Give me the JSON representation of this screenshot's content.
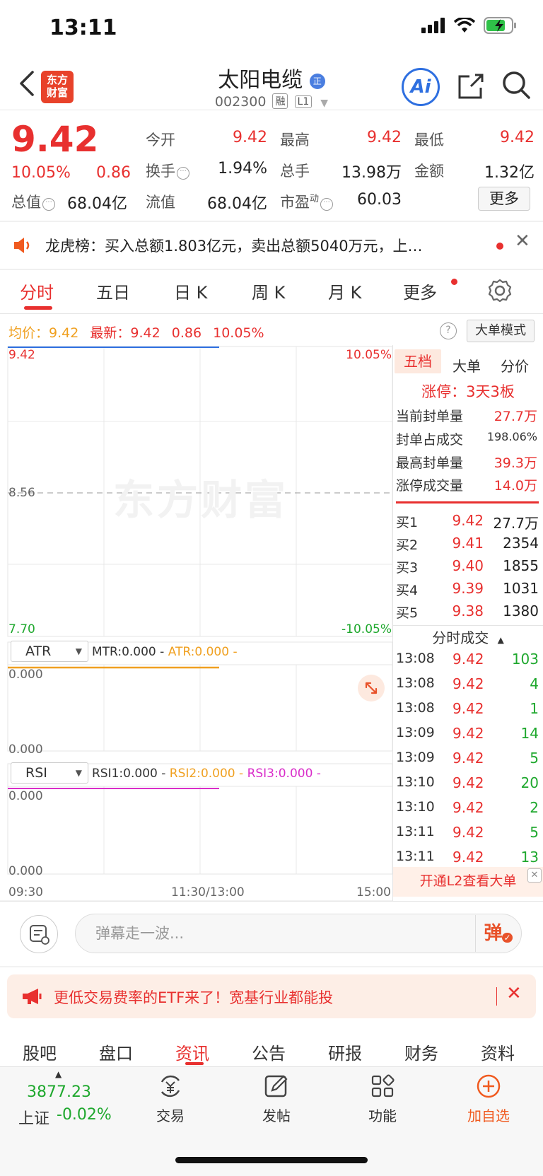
{
  "status": {
    "time": "13:11"
  },
  "header": {
    "logo": "东方\n财富",
    "name": "太阳电缆",
    "code": "002300",
    "tag_rong": "融",
    "tag_level": "L1",
    "ai_label": "Ai"
  },
  "quote": {
    "price": "9.42",
    "pct": "10.05%",
    "change": "0.86",
    "open_label": "今开",
    "open": "9.42",
    "high_label": "最高",
    "high": "9.42",
    "low_label": "最低",
    "low": "9.42",
    "turnover_label": "换手",
    "turnover": "1.94%",
    "volume_label": "总手",
    "volume": "13.98万",
    "amount_label": "金额",
    "amount": "1.32亿",
    "mktcap_label": "总值",
    "mktcap": "68.04亿",
    "float_label": "流值",
    "float": "68.04亿",
    "pe_label": "市盈",
    "pe_sup": "动",
    "pe": "60.03",
    "more": "更多"
  },
  "notice": {
    "text": "龙虎榜：买入总额1.803亿元，卖出总额5040万元，上…"
  },
  "chart_tabs": [
    "分时",
    "五日",
    "日 K",
    "周 K",
    "月 K",
    "更多"
  ],
  "info_line": {
    "avg_label": "均价：",
    "avg": "9.42",
    "latest_label": "最新：",
    "latest": "9.42",
    "change": "0.86",
    "pct": "10.05%",
    "big_order_mode": "大单模式"
  },
  "chart": {
    "watermark": "东方财富",
    "y_top": "9.42",
    "y_mid": "8.56",
    "y_bottom": "7.70",
    "pct_top": "10.05%",
    "pct_bottom": "-10.05%",
    "x_start": "09:30",
    "x_mid": "11:30/13:00",
    "x_end": "15:00",
    "atr": {
      "select": "ATR",
      "mtr": "MTR:0.000 -",
      "atr": "ATR:0.000 -",
      "top": "0.000",
      "bottom": "0.000"
    },
    "rsi": {
      "select": "RSI",
      "rsi1": "RSI1:0.000 -",
      "rsi2": "RSI2:0.000 -",
      "rsi3": "RSI3:0.000 -",
      "top": "0.000",
      "bottom": "0.000"
    }
  },
  "right_panel": {
    "tabs": [
      "五档",
      "大单",
      "分价"
    ],
    "limit_up": "涨停：3天3板",
    "stats": [
      {
        "label": "当前封单量",
        "value": "27.7万"
      },
      {
        "label": "封单占成交",
        "value": "198.06%"
      },
      {
        "label": "最高封单量",
        "value": "39.3万"
      },
      {
        "label": "涨停成交量",
        "value": "14.0万"
      }
    ],
    "bids": [
      {
        "label": "买1",
        "price": "9.42",
        "vol": "27.7万"
      },
      {
        "label": "买2",
        "price": "9.41",
        "vol": "2354"
      },
      {
        "label": "买3",
        "price": "9.40",
        "vol": "1855"
      },
      {
        "label": "买4",
        "price": "9.39",
        "vol": "1031"
      },
      {
        "label": "买5",
        "price": "9.38",
        "vol": "1380"
      }
    ],
    "ticks_title": "分时成交",
    "ticks": [
      {
        "time": "13:08",
        "price": "9.42",
        "vol": "103"
      },
      {
        "time": "13:08",
        "price": "9.42",
        "vol": "4"
      },
      {
        "time": "13:08",
        "price": "9.42",
        "vol": "1"
      },
      {
        "time": "13:09",
        "price": "9.42",
        "vol": "14"
      },
      {
        "time": "13:09",
        "price": "9.42",
        "vol": "5"
      },
      {
        "time": "13:10",
        "price": "9.42",
        "vol": "20"
      },
      {
        "time": "13:10",
        "price": "9.42",
        "vol": "2"
      },
      {
        "time": "13:11",
        "price": "9.42",
        "vol": "5"
      },
      {
        "time": "13:11",
        "price": "9.42",
        "vol": "13"
      }
    ],
    "l2_banner": "开通L2查看大单"
  },
  "danmu": {
    "placeholder": "弹幕走一波...",
    "send": "弹"
  },
  "ad": {
    "text": "更低交易费率的ETF来了！宽基行业都能投"
  },
  "bottom_tabs": [
    "股吧",
    "盘口",
    "资讯",
    "公告",
    "研报",
    "财务",
    "资料"
  ],
  "bottom_nav": {
    "index_value": "3877.23",
    "index_name": "上证",
    "index_pct": "-0.02%",
    "items": [
      "交易",
      "发帖",
      "功能",
      "加自选"
    ]
  },
  "colors": {
    "up": "#e8302f",
    "down": "#1fa82e",
    "accent": "#e8422a",
    "ai": "#2e6fe0"
  }
}
